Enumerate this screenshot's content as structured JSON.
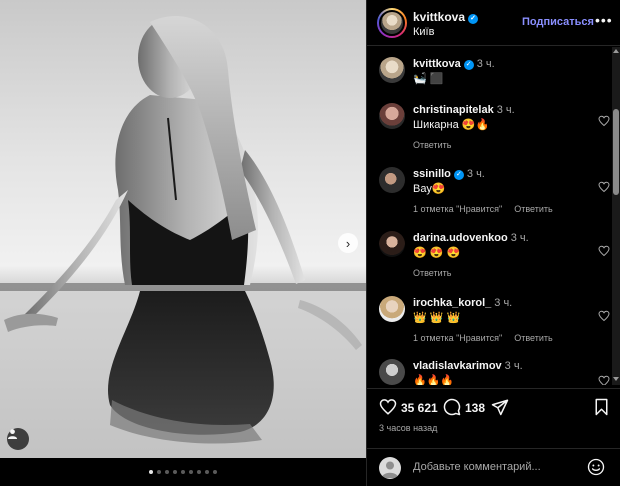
{
  "post": {
    "author": "kvittkova",
    "location": "Київ",
    "follow_label": "Подписаться",
    "more_label": "•••",
    "caption_time": "3 ч.",
    "caption_text": "🛀 ⬛",
    "carousel": {
      "total_slides": 9,
      "active_slide": 1
    }
  },
  "comments": [
    {
      "user": "christinapitelak",
      "verified": false,
      "time": "3 ч.",
      "text": "Шикарна 😍🔥",
      "likes_label": "",
      "reply_label": "Ответить"
    },
    {
      "user": "ssinillo",
      "verified": true,
      "time": "3 ч.",
      "text": "Вау😍",
      "likes_label": "1 отметка \"Нравится\"",
      "reply_label": "Ответить"
    },
    {
      "user": "darina.udovenkoo",
      "verified": false,
      "time": "3 ч.",
      "text": "😍 😍 😍",
      "likes_label": "",
      "reply_label": "Ответить"
    },
    {
      "user": "irochka_korol_",
      "verified": false,
      "time": "3 ч.",
      "text": "👑 👑 👑",
      "likes_label": "1 отметка \"Нравится\"",
      "reply_label": "Ответить"
    },
    {
      "user": "vladislavkarimov",
      "verified": false,
      "time": "3 ч.",
      "text": "🔥🔥🔥",
      "likes_label": "",
      "reply_label": ""
    }
  ],
  "stats": {
    "likes": "35 621",
    "comments": "138",
    "posted_ago": "3 часов назад"
  },
  "add_comment": {
    "placeholder": "Добавьте комментарий..."
  },
  "icons": {
    "verified": "verified-badge-icon",
    "next": "chevron-right-icon",
    "tag": "user-tag-icon",
    "like": "heart-icon",
    "comment": "comment-bubble-icon",
    "share": "paper-plane-icon",
    "save": "bookmark-icon",
    "emoji": "smiley-icon"
  },
  "colors": {
    "follow": "#8a8fff",
    "verified": "#0095f6",
    "background": "#000000",
    "muted": "#a8a8a8"
  }
}
